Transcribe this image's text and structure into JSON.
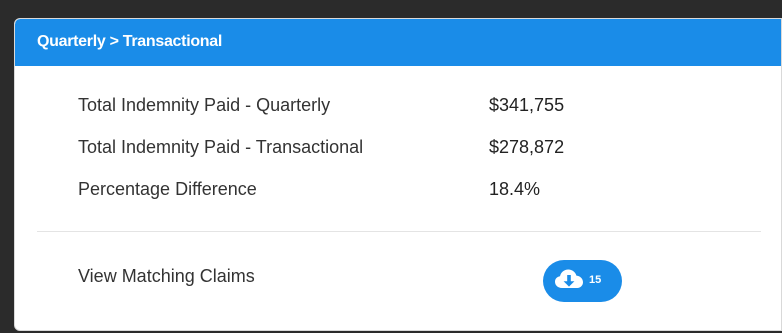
{
  "header": {
    "title": "Quarterly > Transactional"
  },
  "summary": {
    "rows": [
      {
        "label": "Total Indemnity Paid - Quarterly",
        "value": "$341,755"
      },
      {
        "label": "Total Indemnity Paid - Transactional",
        "value": "$278,872"
      },
      {
        "label": "Percentage Difference",
        "value": "18.4%"
      }
    ]
  },
  "claims": {
    "label": "View Matching Claims",
    "count": "15",
    "icon": "cloud-download-icon"
  },
  "colors": {
    "accent": "#1a8ce8",
    "background": "#ffffff",
    "text": "#333333"
  }
}
